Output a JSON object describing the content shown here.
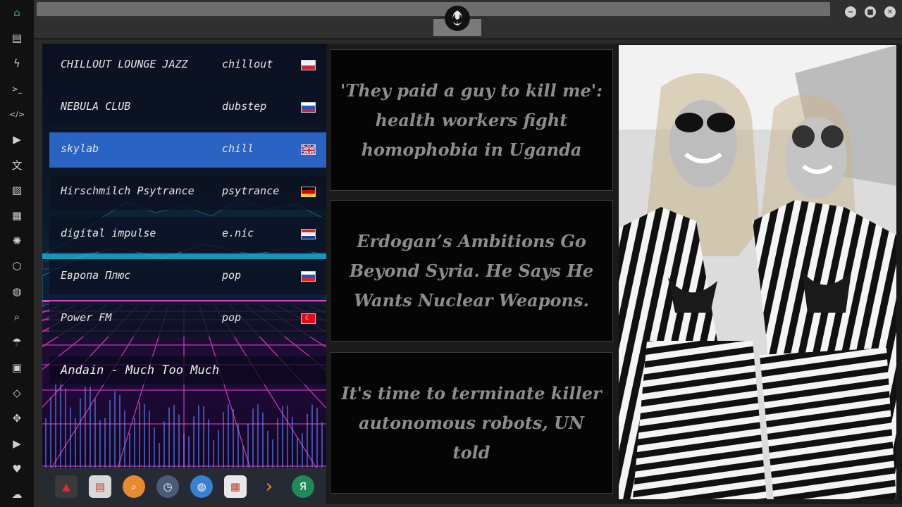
{
  "rail": {
    "icons": [
      "home-icon",
      "document-icon",
      "bolt-icon",
      "terminal-icon",
      "code-icon",
      "play-icon",
      "translate-icon",
      "image-icon",
      "news-icon",
      "rebel-icon",
      "hexagon-icon",
      "globe-icon",
      "search-icon",
      "umbrella-icon",
      "contacts-icon",
      "tag-icon",
      "expand-icon",
      "youtube-icon",
      "heart-icon",
      "cloud-icon"
    ],
    "accent": "#4caf50"
  },
  "radio": {
    "stations": [
      {
        "name": "CHILLOUT LOUNGE JAZZ",
        "genre": "chillout",
        "flag": "poland"
      },
      {
        "name": "NEBULA CLUB",
        "genre": "dubstep",
        "flag": "russia"
      },
      {
        "name": "skylab",
        "genre": "chill",
        "flag": "uk",
        "active": true
      },
      {
        "name": "Hirschmilch Psytrance",
        "genre": "psytrance",
        "flag": "germany"
      },
      {
        "name": "digital impulse",
        "genre": "e.nic",
        "flag": "croatia"
      },
      {
        "name": "Европа Плюс",
        "genre": "pop",
        "flag": "russia"
      },
      {
        "name": "Power FM",
        "genre": "pop",
        "flag": "turkey"
      }
    ],
    "now_playing": "Andain - Much Too Much",
    "active_color": "#2a63c2"
  },
  "dock": {
    "apps": [
      {
        "icon": "triangle-app-icon",
        "glyph": "▲",
        "color": "#3a3a3a"
      },
      {
        "icon": "newspaper-app-icon",
        "glyph": "▤",
        "color": "#d8d8d8"
      },
      {
        "icon": "search-app-icon",
        "glyph": "⌕",
        "color": "#e98a2e"
      },
      {
        "icon": "clock-app-icon",
        "glyph": "◷",
        "color": "#4a5a78"
      },
      {
        "icon": "globe-app-icon",
        "glyph": "◍",
        "color": "#3a7fd0"
      },
      {
        "icon": "calendar-app-icon",
        "glyph": "▦",
        "color": "#e8e8e8"
      },
      {
        "icon": "arrow-app-icon",
        "glyph": "›",
        "color": "#262a33"
      },
      {
        "icon": "yandex-app-icon",
        "glyph": "Я",
        "color": "#1f8a58"
      }
    ]
  },
  "news": {
    "headlines": [
      "'They paid a guy to kill me': health workers fight homophobia in Uganda",
      "Erdogan’s Ambitions Go Beyond Syria. He Says He Wants Nuclear Weapons.",
      "It's time to terminate killer autonomous robots, UN told"
    ]
  },
  "window": {
    "buttons": [
      {
        "name": "minimize-button",
        "glyph": "−"
      },
      {
        "name": "maximize-button",
        "glyph": "■"
      },
      {
        "name": "close-button",
        "glyph": "✕"
      }
    ]
  }
}
